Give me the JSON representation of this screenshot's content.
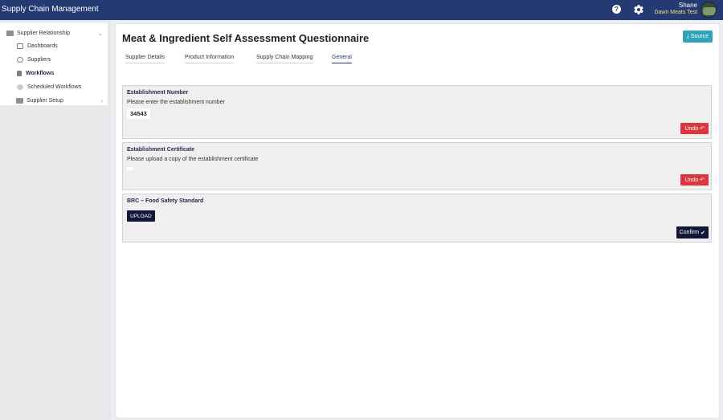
{
  "header": {
    "app_title": "Supply Chain Management",
    "help_icon": "question-circle",
    "settings_icon": "gear",
    "user_name": "Shane",
    "user_company": "Dawn Meats Test"
  },
  "sidebar": {
    "parent": {
      "label": "Supplier Relationship",
      "icon": "truck-icon"
    },
    "items": [
      {
        "label": "Dashboards",
        "icon": "dashboard-icon"
      },
      {
        "label": "Suppliers",
        "icon": "users-icon"
      },
      {
        "label": "Workflows",
        "icon": "document-icon",
        "active": true
      },
      {
        "label": "Scheduled Workflows",
        "icon": "clock-icon"
      }
    ],
    "setup": {
      "label": "Supplier Setup",
      "icon": "settings-box-icon"
    }
  },
  "main": {
    "title": "Meat & Ingredient Self Assessment Questionnaire",
    "source_label": "Source",
    "tabs": [
      {
        "label": "Supplier Details"
      },
      {
        "label": "Product Information"
      },
      {
        "label": "Supply Chain Mapping"
      },
      {
        "label": "General",
        "active": true
      }
    ],
    "questions": [
      {
        "title": "Establishment Number",
        "description": "Please enter the establishment number",
        "value": "34543",
        "action_label": "Undo"
      },
      {
        "title": "Establishment Certificate",
        "description": "Please upload a copy of the establishment certificate",
        "action_label": "Undo"
      },
      {
        "title": "BRC – Food Safety Standard",
        "upload_label": "UPLOAD",
        "action_label": "Confirm"
      }
    ]
  },
  "colors": {
    "header_bg": "#243a73",
    "company_text": "#f2e27a",
    "source_button": "#2fa3b8",
    "undo_button": "#d9363e",
    "dark_button": "#12173a"
  }
}
